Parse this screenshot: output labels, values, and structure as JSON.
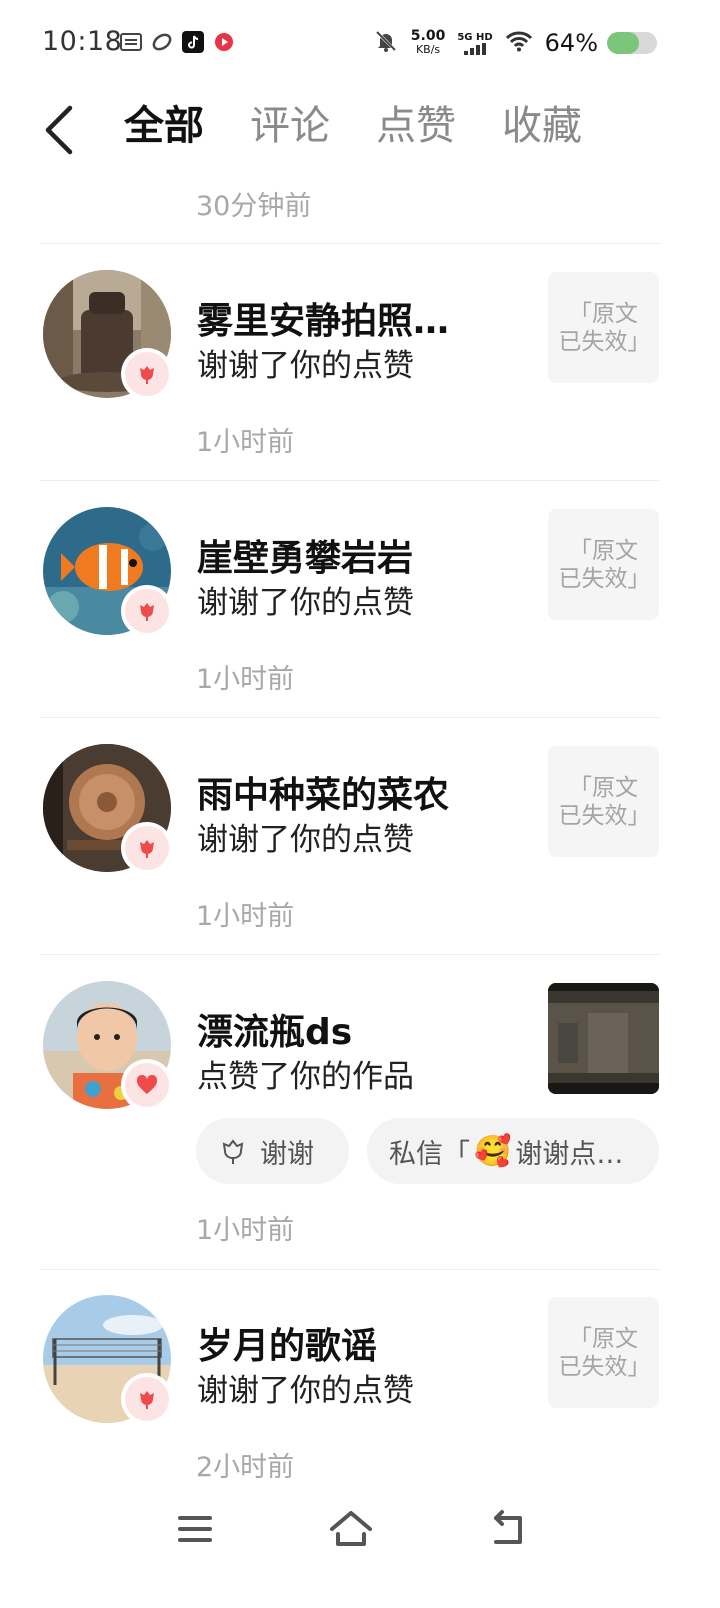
{
  "status": {
    "time": "10:18",
    "net_speed": "5.00",
    "net_unit": "KB/s",
    "net_type_top": "5G HD",
    "battery_text": "64%",
    "battery_level": 0.64
  },
  "nav": {
    "tabs": [
      {
        "label": "全部",
        "active": true
      },
      {
        "label": "评论",
        "active": false
      },
      {
        "label": "点赞",
        "active": false
      },
      {
        "label": "收藏",
        "active": false
      }
    ]
  },
  "top_time": "30分钟前",
  "items": [
    {
      "name": "雾里安静拍照…",
      "action": "谢谢了你的点赞",
      "thumb_text": "「原文已失效」",
      "time": "1小时前"
    },
    {
      "name": "崖壁勇攀岩岩",
      "action": "谢谢了你的点赞",
      "thumb_text": "「原文已失效」",
      "time": "1小时前"
    },
    {
      "name": "雨中种菜的菜农",
      "action": "谢谢了你的点赞",
      "thumb_text": "「原文已失效」",
      "time": "1小时前"
    },
    {
      "name": "漂流瓶ds",
      "action": "点赞了你的作品",
      "thumb_text": "",
      "time": "1小时前",
      "quick_reply": {
        "thanks_label": "谢谢",
        "dm_prefix": "私信「",
        "dm_emoji": "🥰",
        "dm_text": "谢谢点…"
      }
    },
    {
      "name": "岁月的歌谣",
      "action": "谢谢了你的点赞",
      "thumb_text": "「原文已失效」",
      "time": "2小时前"
    }
  ],
  "colors": {
    "accent_red": "#f04a4a",
    "badge_bg": "#fde4e4",
    "muted_text": "#a8a8a8",
    "battery_green": "#7bc67b"
  }
}
